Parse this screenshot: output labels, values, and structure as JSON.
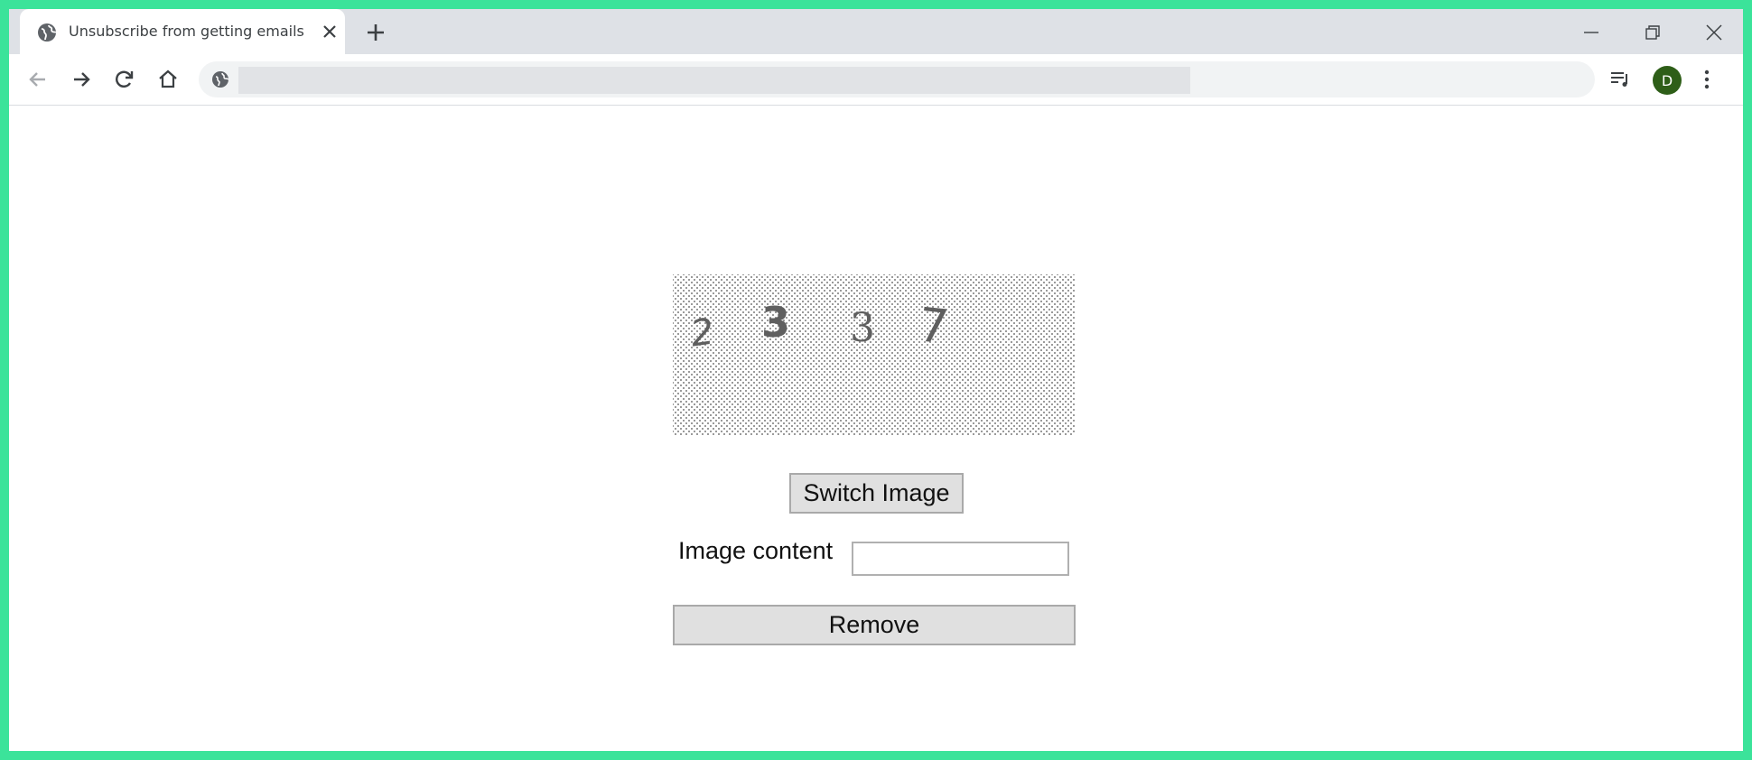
{
  "browser": {
    "tab": {
      "title": "Unsubscribe from getting emails",
      "favicon": "globe-icon",
      "close_icon": "close-icon"
    },
    "new_tab_icon": "plus-icon",
    "window_controls": [
      "minimize-icon",
      "restore-icon",
      "close-icon"
    ],
    "toolbar": {
      "back_icon": "back-arrow-icon",
      "forward_icon": "forward-arrow-icon",
      "reload_icon": "reload-icon",
      "home_icon": "home-icon",
      "omnibox_icon": "globe-icon",
      "omnibox_value": "",
      "media_icon": "media-queue-icon",
      "avatar_letter": "D",
      "menu_icon": "kebab-menu-icon"
    }
  },
  "page": {
    "captcha": {
      "digits": [
        "2",
        "3",
        "3",
        "7"
      ]
    },
    "switch_button_label": "Switch Image",
    "image_content_label": "Image content",
    "image_content_value": "",
    "remove_button_label": "Remove"
  },
  "colors": {
    "frame": "#3be39a",
    "tabstrip": "#dee1e6",
    "avatar": "#2e5e18",
    "button_bg": "#e0e0e0"
  }
}
